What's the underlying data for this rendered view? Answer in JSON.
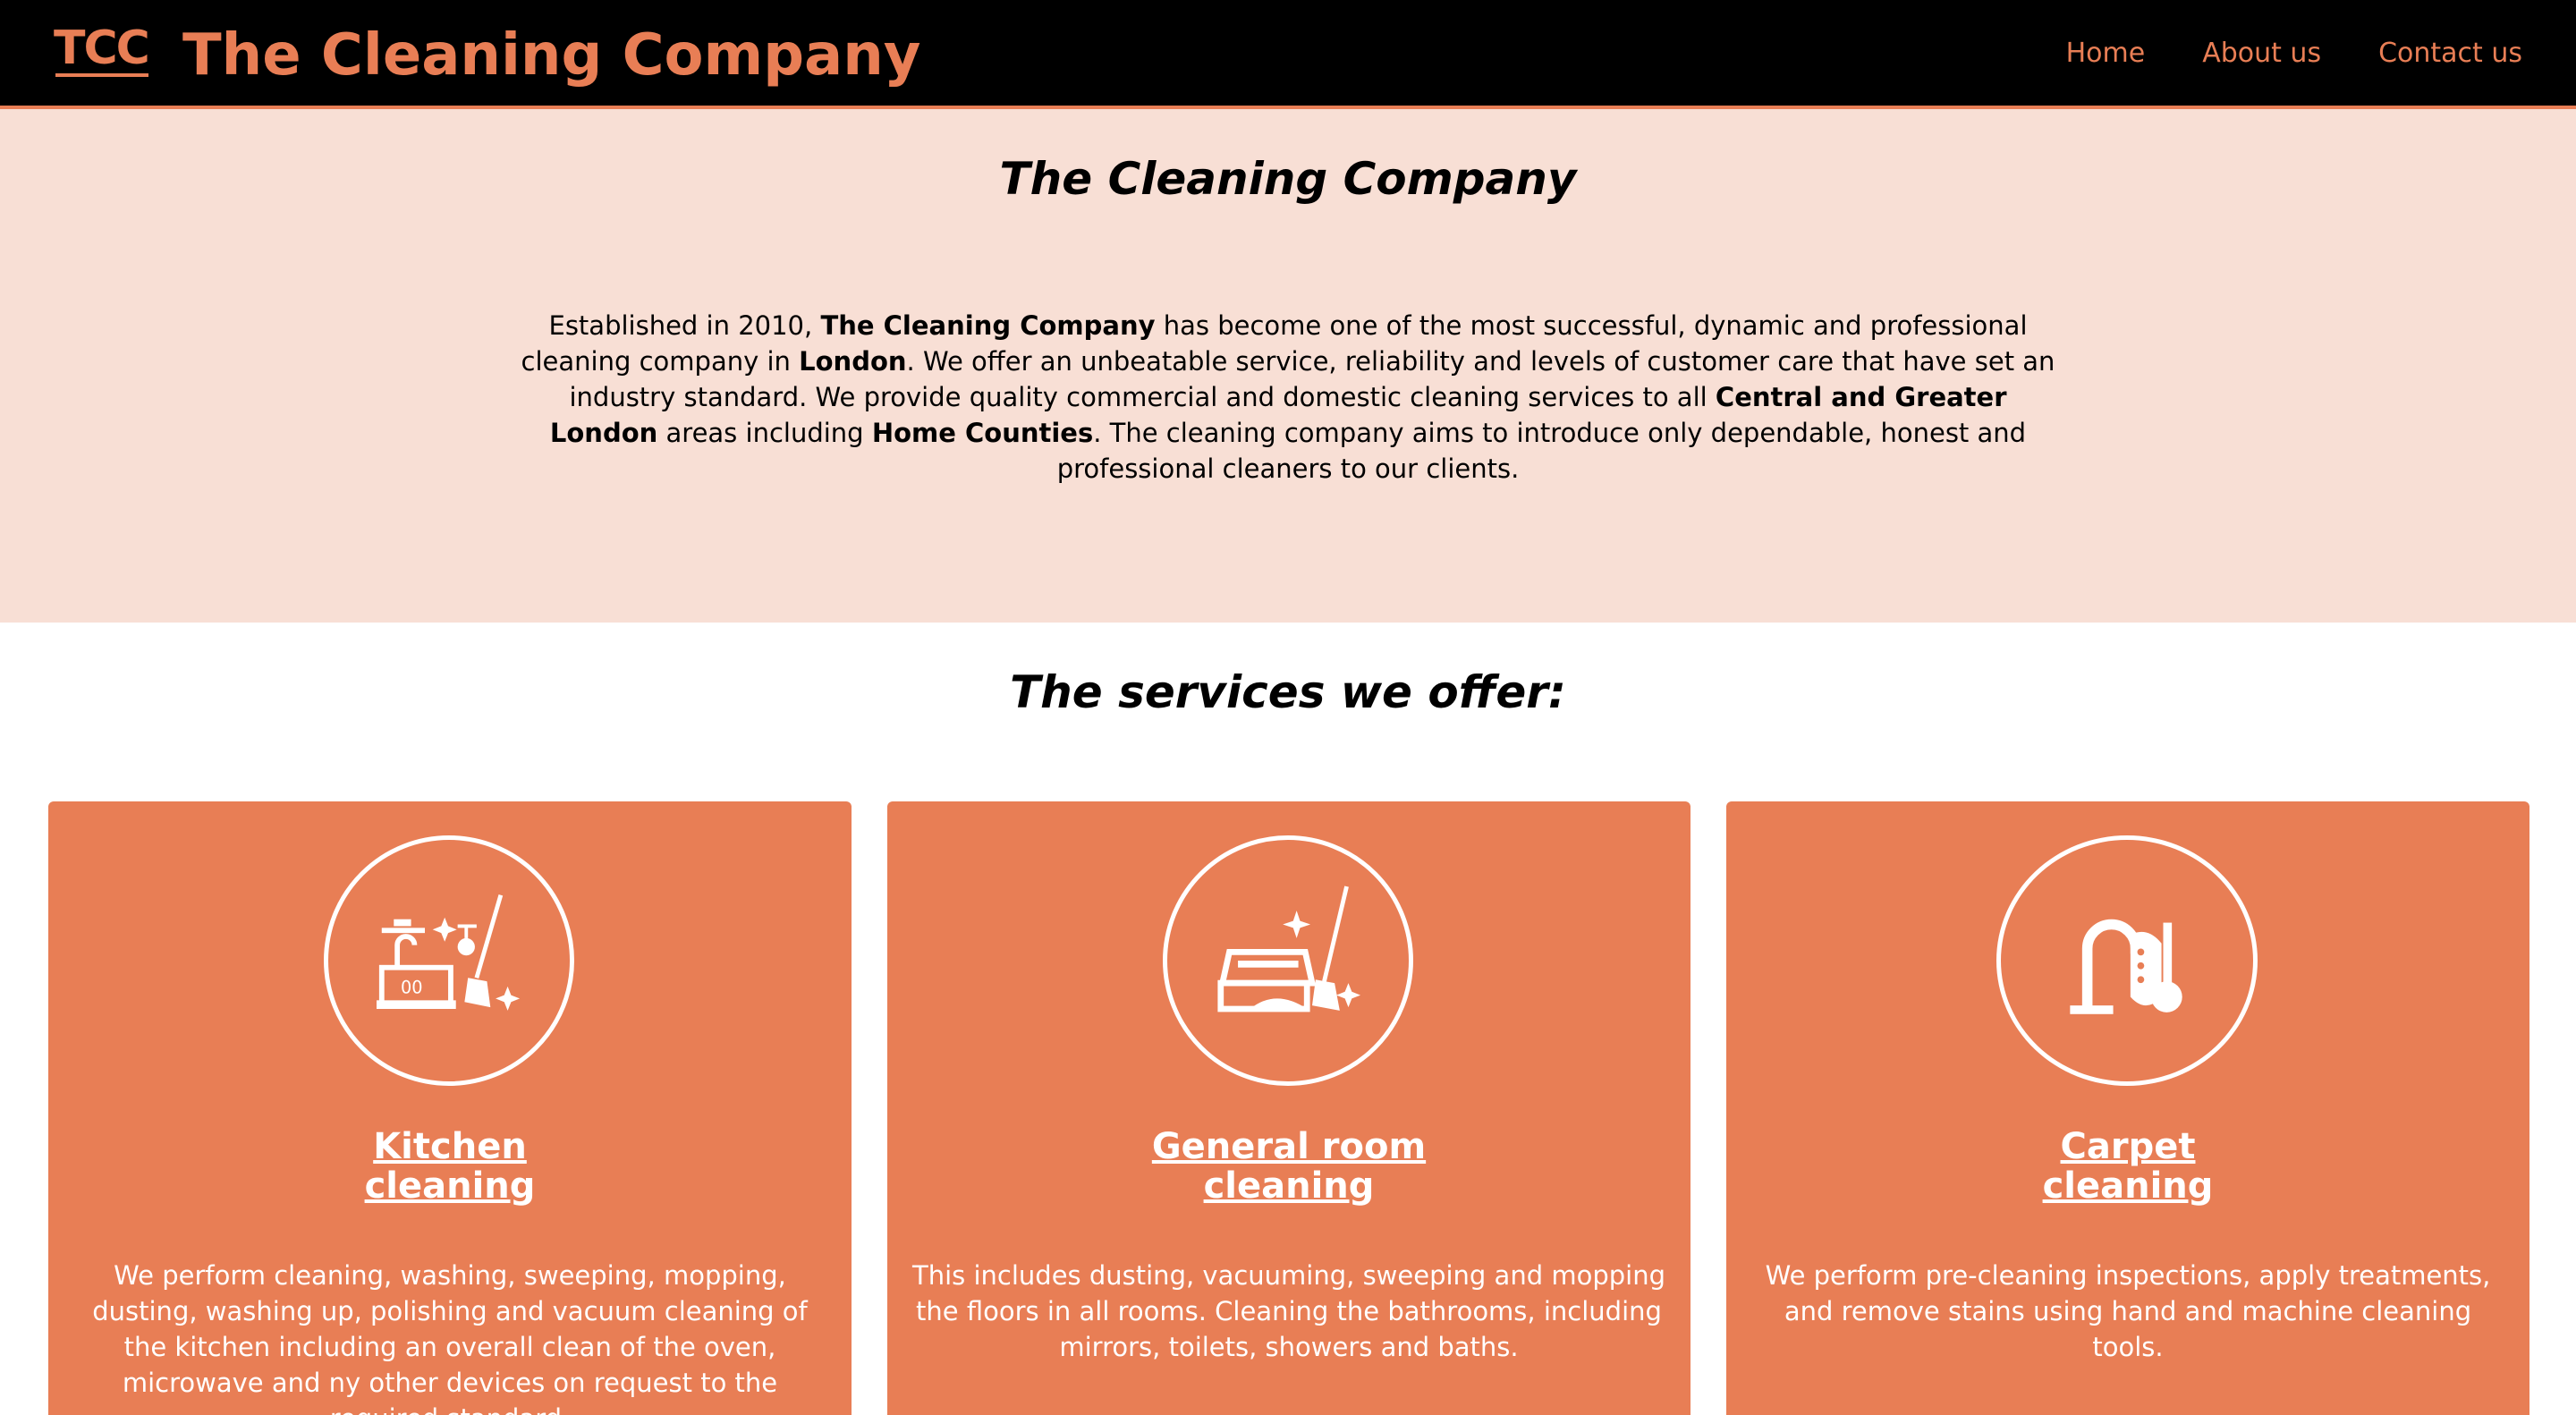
{
  "header": {
    "logo_text": "TCC",
    "brand": "The Cleaning Company",
    "nav": [
      "Home",
      "About us",
      "Contact us"
    ],
    "accent_color": "#e87e55"
  },
  "intro": {
    "title": "The Cleaning Company",
    "p1": "Established in 2010, ",
    "b1": "The Cleaning Company",
    "p2": " has become one of the most successful, dynamic and professional cleaning company in ",
    "b2": "London",
    "p3": ". We offer an unbeatable service, reliability and levels of customer care that have set an industry standard. We provide quality commercial and domestic cleaning services to all ",
    "b3": "Central and Greater London",
    "p4": " areas including ",
    "b4": "Home Counties",
    "p5": ". The cleaning company aims to introduce only dependable, honest and professional cleaners to our clients.",
    "background": "#f8dfd5"
  },
  "services": {
    "title": "The services we offer:",
    "cards": [
      {
        "icon": "kitchen-cleaning-icon",
        "title_line1": "Kitchen",
        "title_line2": "cleaning",
        "description": "We perform cleaning, washing, sweeping, mopping, dusting, washing up, polishing and vacuum cleaning of the kitchen including an overall clean of the oven, microwave and ny other devices on request to the required standard."
      },
      {
        "icon": "room-cleaning-icon",
        "title_line1": "General room",
        "title_line2": "cleaning",
        "description": "This includes dusting, vacuuming, sweeping and mopping the floors in all rooms. Cleaning the bathrooms, including mirrors, toilets, showers and baths."
      },
      {
        "icon": "vacuum-cleaner-icon",
        "title_line1": "Carpet",
        "title_line2": "cleaning",
        "description": "We perform pre-cleaning inspections, apply treatments, and remove stains using hand and machine cleaning tools."
      }
    ]
  }
}
